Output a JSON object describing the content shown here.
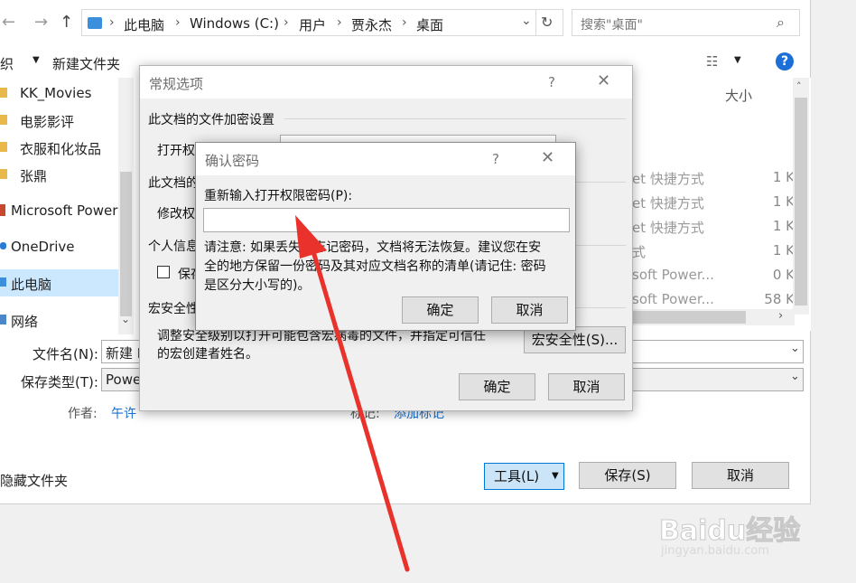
{
  "address": {
    "crumbs": [
      "此电脑",
      "Windows (C:)",
      "用户",
      "贾永杰",
      "桌面"
    ],
    "search_placeholder": "搜索\"桌面\""
  },
  "toolbar": {
    "organize_label": "织",
    "new_folder_label": "新建文件夹"
  },
  "nav": {
    "items": [
      {
        "label": "KK_Movies",
        "icon": "folder-icon"
      },
      {
        "label": "电影影评",
        "icon": "folder-icon"
      },
      {
        "label": "衣服和化妆品",
        "icon": "folder-icon"
      },
      {
        "label": "张鼎",
        "icon": "folder-icon"
      },
      {
        "label": "Microsoft Power",
        "icon": "powerpoint-icon"
      },
      {
        "label": "OneDrive",
        "icon": "cloud-icon"
      },
      {
        "label": "此电脑",
        "icon": "computer-icon"
      },
      {
        "label": "网络",
        "icon": "network-icon"
      }
    ]
  },
  "files": {
    "size_header": "大小",
    "rows": [
      {
        "type": "et 快捷方式",
        "size": "1 K"
      },
      {
        "type": "et 快捷方式",
        "size": "1 K"
      },
      {
        "type": "et 快捷方式",
        "size": "1 K"
      },
      {
        "type": "式",
        "size": "1 K"
      },
      {
        "type": "soft Power...",
        "size": "0 K"
      },
      {
        "type": "soft Power...",
        "size": "58 K"
      }
    ]
  },
  "form": {
    "filename_label": "文件名(N):",
    "filename_value": "新建 I",
    "filetype_label": "保存类型(T):",
    "filetype_value": "Powe",
    "author_label": "作者:",
    "author_value": "午许",
    "tags_label": "标记:",
    "tags_value": "添加标记",
    "hide_folders_label": "隐藏文件夹",
    "tools_label": "工具(L)",
    "save_label": "保存(S)",
    "cancel_label": "取消"
  },
  "general_dialog": {
    "title": "常规选项",
    "help": "?",
    "encrypt_heading": "此文档的文件加密设置",
    "open_pw_label": "打开权",
    "share_heading": "此文档的",
    "modify_pw_label": "修改权",
    "privacy_heading": "个人信息",
    "privacy_checkbox_label": "保存",
    "macro_heading": "宏安全性",
    "macro_text_line1": "调整安全级别以打开可能包含宏病毒的文件，并指定可信任",
    "macro_text_line2": "的宏创建者姓名。",
    "macro_button": "宏安全性(S)...",
    "ok": "确定",
    "cancel": "取消"
  },
  "confirm_dialog": {
    "title": "确认密码",
    "help": "?",
    "prompt": "重新输入打开权限密码(P):",
    "password_value": "",
    "warning_line1": "请注意: 如果丢失或忘记密码，文档将无法恢复。建议您在安",
    "warning_line2": "全的地方保留一份密码及其对应文档名称的清单(请记住: 密码",
    "warning_line3": "是区分大小写的)。",
    "ok": "确定",
    "cancel": "取消"
  },
  "watermark": {
    "brand": "Baidu经验",
    "url": "jingyan.baidu.com"
  },
  "colors": {
    "accent": "#1b6fd6",
    "annotation_arrow": "#e8322b",
    "link": "#1a6fd0"
  }
}
